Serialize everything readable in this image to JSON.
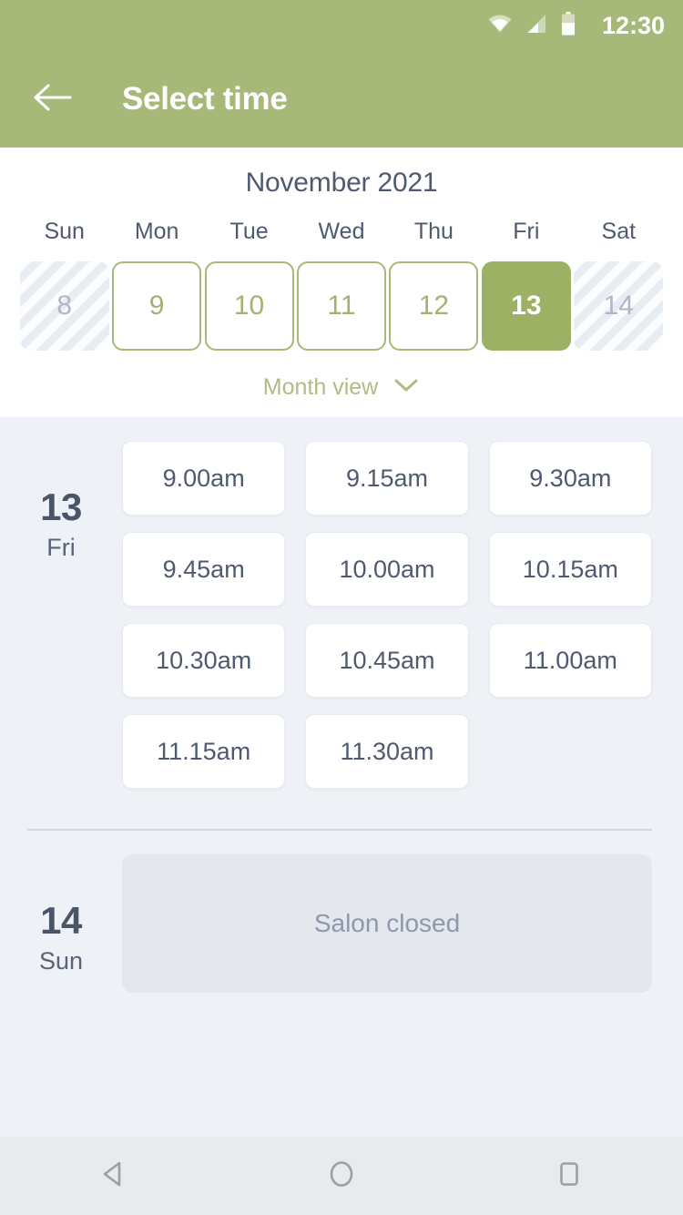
{
  "status_bar": {
    "time": "12:30",
    "icons": [
      "wifi-icon",
      "cell-signal-icon",
      "battery-icon"
    ]
  },
  "app_bar": {
    "back_icon": "arrow-left-icon",
    "title": "Select time"
  },
  "calendar": {
    "month_title": "November 2021",
    "weekdays": [
      "Sun",
      "Mon",
      "Tue",
      "Wed",
      "Thu",
      "Fri",
      "Sat"
    ],
    "days": [
      {
        "number": "8",
        "state": "disabled"
      },
      {
        "number": "9",
        "state": "available"
      },
      {
        "number": "10",
        "state": "available"
      },
      {
        "number": "11",
        "state": "available"
      },
      {
        "number": "12",
        "state": "available"
      },
      {
        "number": "13",
        "state": "selected"
      },
      {
        "number": "14",
        "state": "disabled"
      }
    ],
    "month_view_label": "Month view",
    "month_view_icon": "chevron-down-icon"
  },
  "day_sections": [
    {
      "day_number": "13",
      "day_name": "Fri",
      "slots": [
        "9.00am",
        "9.15am",
        "9.30am",
        "9.45am",
        "10.00am",
        "10.15am",
        "10.30am",
        "10.45am",
        "11.00am",
        "11.15am",
        "11.30am"
      ]
    },
    {
      "day_number": "14",
      "day_name": "Sun",
      "closed_label": "Salon closed"
    }
  ],
  "nav_bar": {
    "back_icon": "nav-back-triangle-icon",
    "home_icon": "nav-home-circle-icon",
    "recents_icon": "nav-recents-square-icon"
  },
  "colors": {
    "brand_green": "#A7B978",
    "selected_green": "#9CB164",
    "body_bg": "#EEF1F6",
    "text_dark": "#4F5A70",
    "text_muted": "#8E98AC"
  }
}
